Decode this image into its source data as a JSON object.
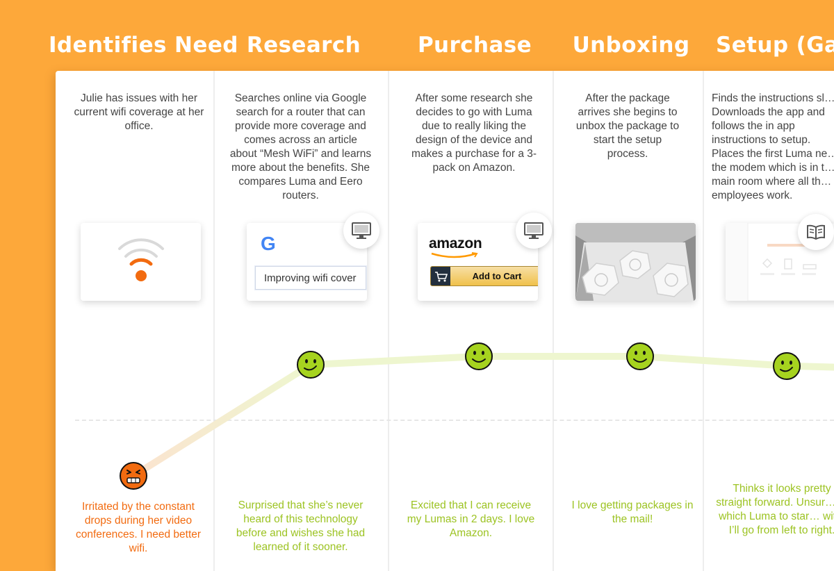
{
  "stages": [
    {
      "title": "Identifies Need",
      "description": "Julie has issues with her current wifi coverage at her office.",
      "card_type": "wifi",
      "device_badge": "",
      "emotion": "negative",
      "emotion_text": "Irritated by the constant drops during her video conferences. I need better wifi."
    },
    {
      "title": "Research",
      "description": "Searches online via Google search for a router that can provide more coverage and comes across an article about “Mesh WiFi” and learns more about the benefits. She compares Luma and Eero routers.",
      "card_type": "google",
      "device_badge": "monitor-icon",
      "emotion": "positive",
      "emotion_text": "Surprised that she’s never heard of this technology before and wishes she had learned of it sooner."
    },
    {
      "title": "Purchase",
      "description": "After some research she decides to go with Luma due to really liking the design of the device and makes a purchase for a 3-pack on Amazon.",
      "card_type": "amazon",
      "device_badge": "monitor-icon",
      "emotion": "positive",
      "emotion_text": "Excited that I can receive my Lumas in 2 days. I love Amazon."
    },
    {
      "title": "Unboxing",
      "description": "After the package arrives she begins to unbox the package to start the setup process.",
      "card_type": "photo",
      "device_badge": "",
      "emotion": "positive",
      "emotion_text": "I love getting packages in the mail!"
    },
    {
      "title": "Setup (Gate",
      "description": "Finds the instructions sl… Downloads the app and follows the in app instructions to setup. Places the first Luma ne… the modem which is in t… main room where all th… employees work.",
      "card_type": "app",
      "device_badge": "book-icon",
      "emotion": "positive",
      "emotion_text": "Thinks it looks pretty straight forward. Unsur… of which Luma to star… with. I’ll go from left to right."
    }
  ],
  "google": {
    "logo": "G",
    "search_value": "Improving wifi cover"
  },
  "amazon": {
    "logo": "amazon",
    "button_label": "Add to Cart"
  },
  "colors": {
    "background": "#FDA83A",
    "negative": "#F26B10",
    "positive": "#9CC322",
    "face_positive": "#A6D31F",
    "face_negative": "#F26B10",
    "curve": "#EEF6CF"
  },
  "emotion_curve": {
    "scale": [
      "negative",
      "positive"
    ],
    "levels": [
      0.0,
      0.93,
      1.0,
      1.0,
      0.92
    ]
  }
}
